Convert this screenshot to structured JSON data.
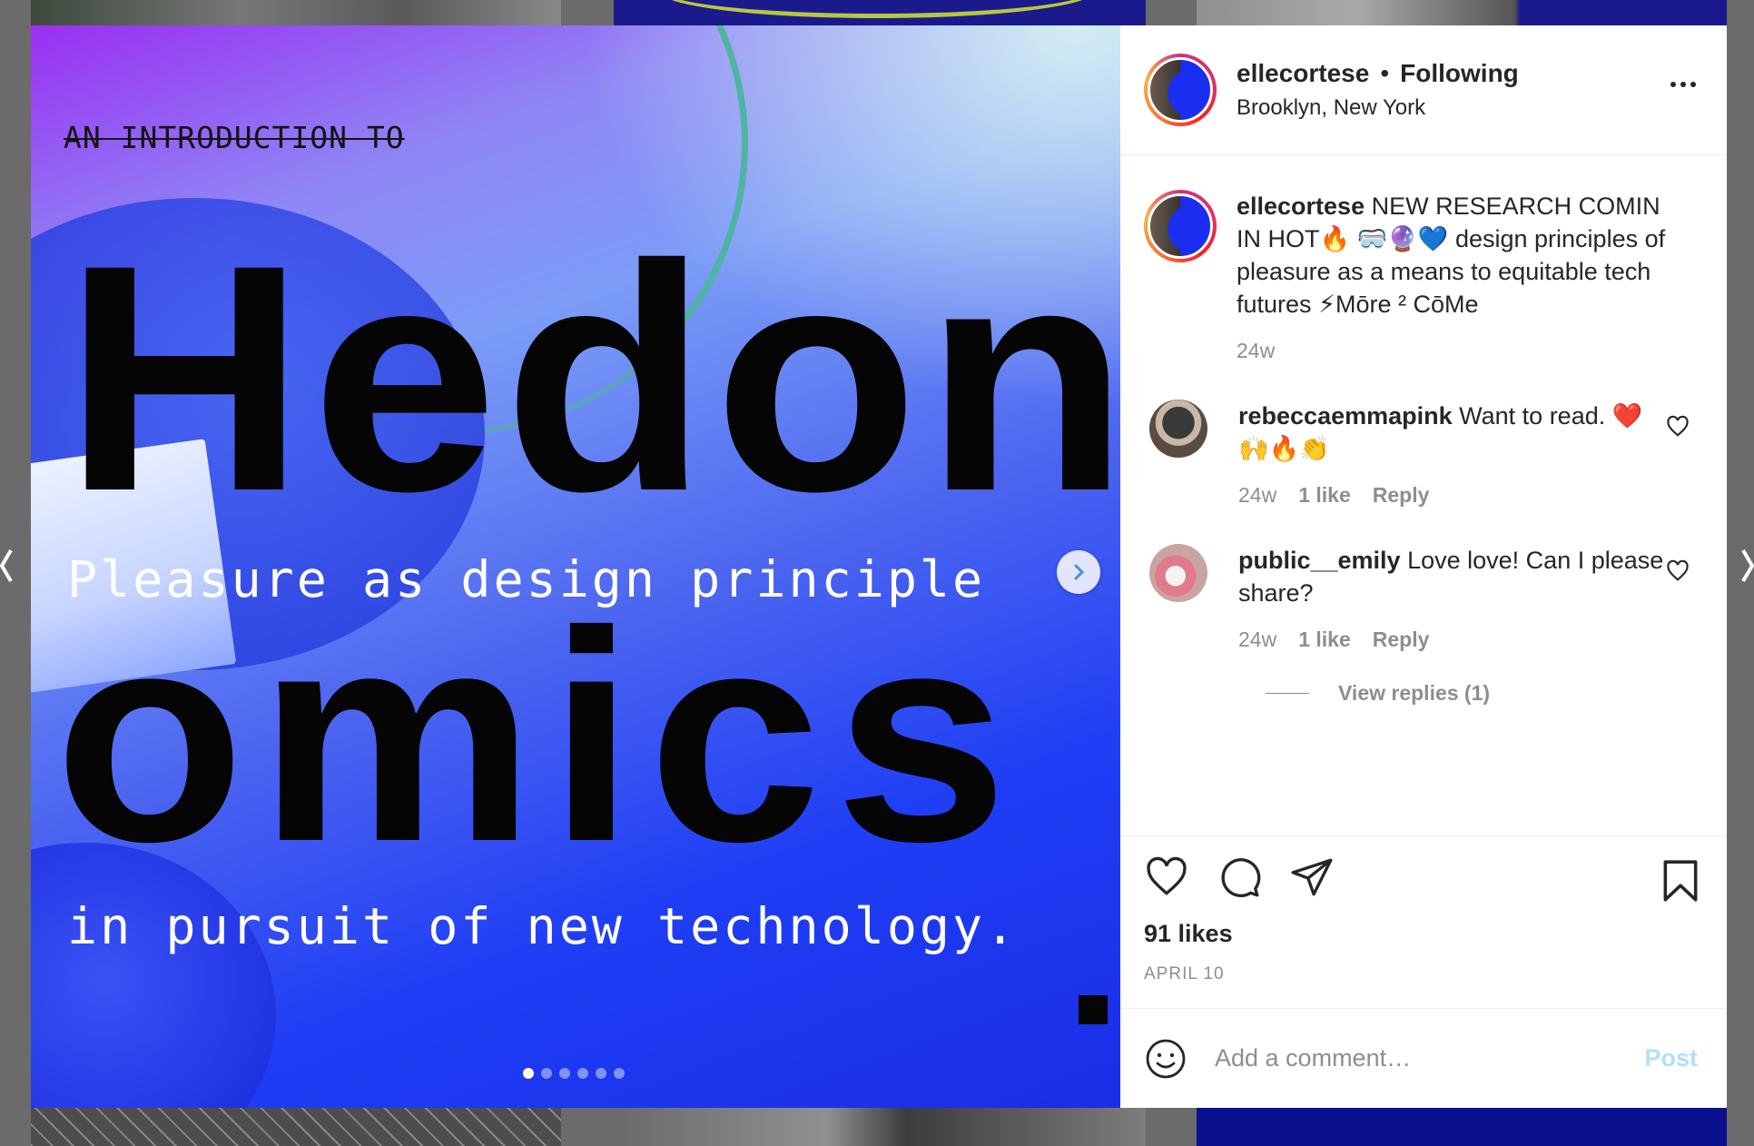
{
  "post": {
    "username": "ellecortese",
    "follow_status": "Following",
    "separator": "•",
    "location": "Brooklyn, New York"
  },
  "media": {
    "intro": "AN INTRODUCTION TO",
    "word_top": "Hedon·",
    "word_bottom": "omics",
    "line_one": "Pleasure as design principle",
    "line_two": "in pursuit of new technology.",
    "slide_count": 6,
    "active_slide": 1
  },
  "caption": {
    "username": "ellecortese",
    "text": "NEW RESEARCH COMIN IN HOT🔥 🥽🔮💙 design principles of pleasure as a means to equitable tech futures ⚡Mōre ² CōMe",
    "time": "24w"
  },
  "comments": [
    {
      "username": "rebeccaemmapink",
      "text": "Want to read. ❤️🙌🔥👏",
      "time": "24w",
      "likes": "1 like",
      "reply": "Reply"
    },
    {
      "username": "public__emily",
      "text": "Love love! Can I please share?",
      "time": "24w",
      "likes": "1 like",
      "reply": "Reply"
    }
  ],
  "view_replies": "View replies (1)",
  "likes": "91 likes",
  "date": "APRIL 10",
  "add_comment": {
    "placeholder": "Add a comment…",
    "post_label": "Post"
  },
  "colors": {
    "accent_blue": "#0095f6",
    "post_disabled": "#b2dffc",
    "text": "#262626",
    "muted": "#8e8e8e"
  }
}
